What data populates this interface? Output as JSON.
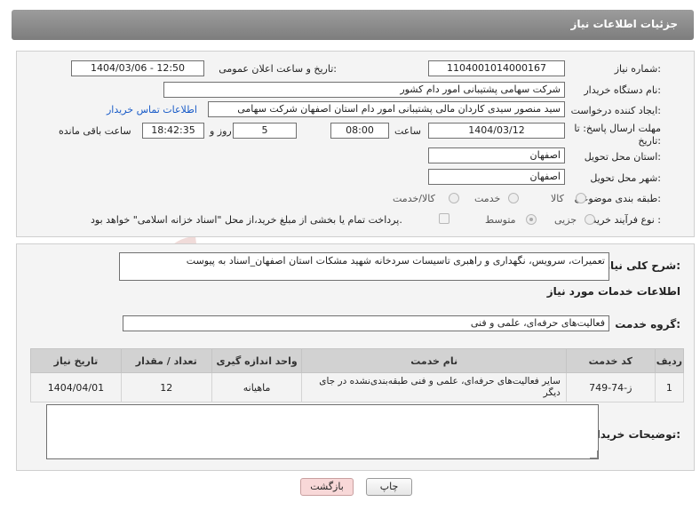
{
  "header": {
    "title": "جزئیات اطلاعات نیاز"
  },
  "form": {
    "need_number_label": "شماره نیاز:",
    "need_number": "1104001014000167",
    "announce_label": "تاریخ و ساعت اعلان عمومی:",
    "announce_value": "1404/03/06 - 12:50",
    "buyer_org_label": "نام دستگاه خریدار:",
    "buyer_org": "شرکت سهامی پشتیبانی امور دام کشور",
    "creator_label": "ایجاد کننده درخواست:",
    "creator": "سید منصور سیدی کاردان مالی پشتیبانی امور دام استان اصفهان شرکت سهامی",
    "contact_link": "اطلاعات تماس خریدار",
    "deadline_label_1": "مهلت ارسال پاسخ: تا",
    "deadline_label_2": "تاریخ:",
    "deadline_date": "1404/03/12",
    "time_label": "ساعت",
    "deadline_time": "08:00",
    "days_value": "5",
    "days_label": "روز و",
    "remaining_time": "18:42:35",
    "remaining_label": "ساعت باقی مانده",
    "province_label": "استان محل تحویل:",
    "province": "اصفهان",
    "city_label": "شهر محل تحویل:",
    "city": "اصفهان",
    "category_label": "طبقه بندی موضوعی:",
    "category_options": [
      "کالا",
      "خدمت",
      "کالا/خدمت"
    ],
    "purchase_type_label": "نوع فرآیند خرید :",
    "purchase_type_options": [
      "جزیی",
      "متوسط"
    ],
    "payment_note": "پرداخت تمام یا بخشی از مبلغ خرید،از محل \"اسناد خزانه اسلامی\" خواهد بود."
  },
  "description": {
    "label": "شرح کلی نیاز:",
    "value": "تعمیرات، سرویس، نگهداری و راهبری تاسیسات سردخانه شهید مشکات استان اصفهان_اسناد به پیوست"
  },
  "services": {
    "section_title": "اطلاعات خدمات مورد نیاز",
    "group_label": "گروه خدمت:",
    "group_value": "فعالیت‌های حرفه‌ای، علمی و فنی",
    "columns": [
      "ردیف",
      "کد خدمت",
      "نام خدمت",
      "واحد اندازه گیری",
      "تعداد / مقدار",
      "تاریخ نیاز"
    ],
    "rows": [
      {
        "row": "1",
        "code": "ز-74-749",
        "name": "سایر فعالیت‌های حرفه‌ای، علمی و فنی طبقه‌بندی‌نشده در جای دیگر",
        "unit": "ماهیانه",
        "qty": "12",
        "date": "1404/04/01"
      }
    ]
  },
  "buyer_notes": {
    "label": "توضیحات خریدار:",
    "value": ""
  },
  "buttons": {
    "print": "چاپ",
    "back": "بازگشت"
  },
  "colors": {
    "header": "#8a8a8a",
    "link": "#1a5cc8",
    "back_button": "#f8d8d8",
    "watermark": "#e3b8b4"
  }
}
